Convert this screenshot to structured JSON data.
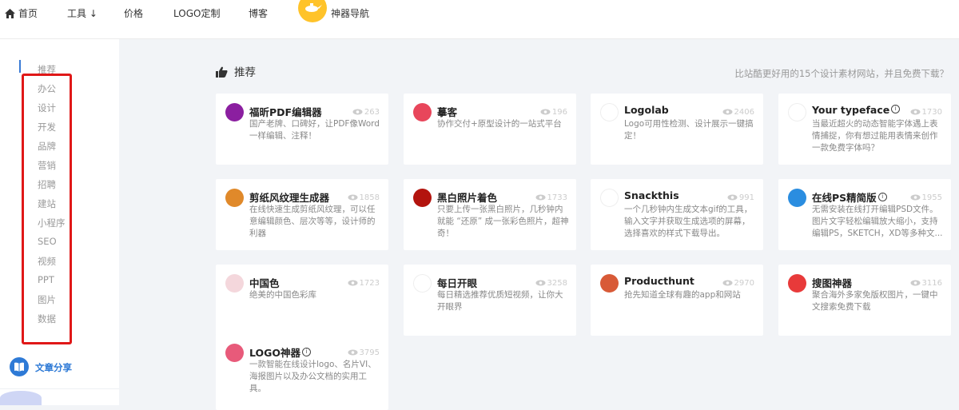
{
  "nav": {
    "home": "首页",
    "tools": "工具 ↓",
    "price": "价格",
    "logo": "LOGO定制",
    "blog": "博客",
    "nav_tools": "神器导航"
  },
  "sidebar": {
    "items": [
      "推荐",
      "办公",
      "设计",
      "开发",
      "品牌",
      "营销",
      "招聘",
      "建站",
      "小程序",
      "SEO",
      "视频",
      "PPT",
      "图片",
      "数据"
    ],
    "share": "文章分享"
  },
  "section": {
    "title": "推荐",
    "subtitle": "比站酷更好用的15个设计素材网站，并且免费下载？"
  },
  "cards": [
    {
      "name": "福昕PDF编辑器",
      "views": "263",
      "desc": "国产老牌、口碑好，让PDF像Word一样编辑、注释！",
      "icon": "foxit-pdf-icon",
      "color": "#8b1fa0"
    },
    {
      "name": "摹客",
      "views": "196",
      "desc": "协作交付+原型设计的一站式平台",
      "icon": "mockplus-icon",
      "color": "#e8465b"
    },
    {
      "name": "Logolab",
      "views": "2406",
      "desc": "Logo可用性检测、设计展示一键搞定！",
      "icon": "logolab-icon",
      "color": "#ffffff"
    },
    {
      "name": "Your typeface",
      "views": "1730",
      "desc": "当最近超火的动态智能字体遇上表情捕捉，你有想过能用表情来创作一款免费字体吗？",
      "icon": "face-icon",
      "color": "#ffffff",
      "info": "i"
    },
    {
      "name": "剪纸风纹理生成器",
      "views": "1858",
      "desc": "在线快速生成剪纸风纹理，可以任意编辑颜色、层次等等，设计师的利器",
      "icon": "papercut-icon",
      "color": "#e0892a"
    },
    {
      "name": "黑白照片着色",
      "views": "1733",
      "desc": "只要上传一张黑白照片，几秒钟内就能 “还原” 成一张彩色照片，超神奇！",
      "icon": "colorize-icon",
      "color": "#b3140e"
    },
    {
      "name": "Snackthis",
      "views": "991",
      "desc": "一个几秒钟内生成文本gif的工具，输入文字并获取生成选项的屏幕，选择喜欢的样式下载导出。",
      "icon": "snackthis-icon",
      "color": "#ffffff"
    },
    {
      "name": "在线PS精简版",
      "views": "1955",
      "desc": "无需安装在线打开编辑PSD文件。图片文字轻松编辑放大缩小，支持编辑PS，SKETCH，XD等多种文...",
      "icon": "photoshop-icon",
      "color": "#2a8de0",
      "info": "i"
    },
    {
      "name": "中国色",
      "views": "1723",
      "desc": "绝美的中国色彩库",
      "icon": "chinese-color-icon",
      "color": "#f4d7dc"
    },
    {
      "name": "每日开眼",
      "views": "3258",
      "desc": "每日精选推荐优质短视频，让你大开眼界",
      "icon": "eyepetizer-icon",
      "color": "#ffffff"
    },
    {
      "name": "Producthunt",
      "views": "2970",
      "desc": "抢先知道全球有趣的app和网站",
      "icon": "producthunt-icon",
      "color": "#d85a37"
    },
    {
      "name": "搜图神器",
      "views": "3116",
      "desc": "聚合海外多家免版权图片，一键中文搜索免费下载",
      "icon": "image-search-icon",
      "color": "#e83a3a"
    },
    {
      "name": "LOGO神器",
      "views": "3795",
      "desc": "一款智能在线设计logo、名片VI、海报图片以及办公文档的实用工具。",
      "icon": "logo-maker-icon",
      "color": "#e85a7a",
      "info": "i"
    }
  ]
}
